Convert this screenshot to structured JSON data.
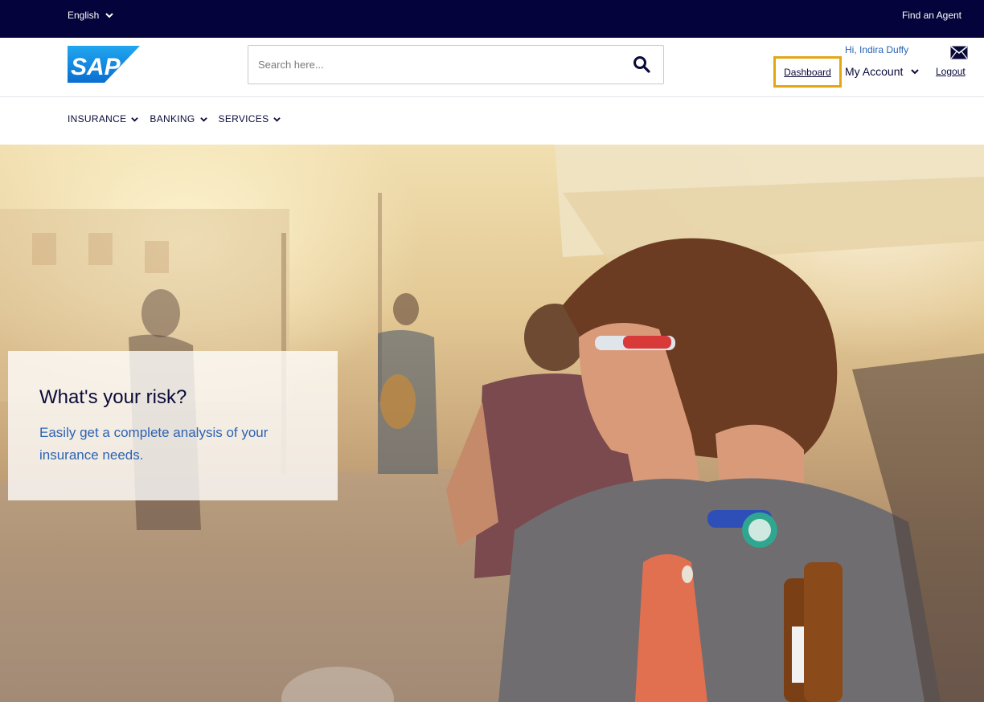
{
  "topbar": {
    "language": "English",
    "find_agent": "Find an Agent"
  },
  "header": {
    "logo_text": "SAP",
    "search": {
      "placeholder": "Search here..."
    },
    "greeting": "Hi, Indira Duffy",
    "dashboard_label": "Dashboard",
    "my_account_label": "My Account",
    "logout_label": "Logout",
    "highlight_color": "#e3a615"
  },
  "nav": {
    "items": [
      {
        "label": "INSURANCE"
      },
      {
        "label": "BANKING"
      },
      {
        "label": "SERVICES"
      }
    ]
  },
  "hero": {
    "title": "What's your risk?",
    "subtitle": "Easily get a complete analysis of your insurance needs."
  },
  "colors": {
    "topbar": "#04033b",
    "text_dark": "#0a0a3a",
    "link_blue": "#2b63b5"
  }
}
